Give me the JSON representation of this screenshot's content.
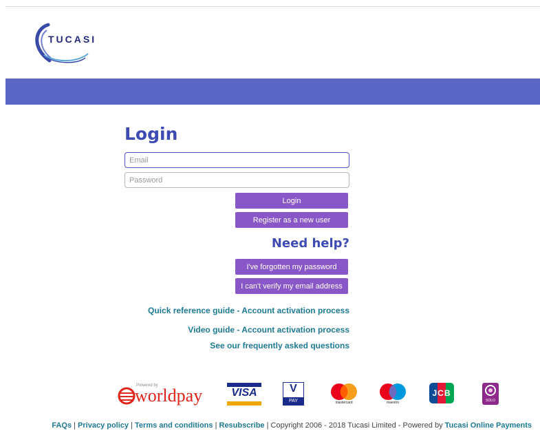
{
  "brand": {
    "name": "TUCASI",
    "color": "#3e4bb5",
    "banner_color": "#5a67c5",
    "button_color": "#8a57c8"
  },
  "login": {
    "title": "Login",
    "email_placeholder": "Email",
    "password_placeholder": "Password",
    "login_button": "Login",
    "register_button": "Register as a new user"
  },
  "help": {
    "title": "Need help?",
    "forgot_password_button": "I've forgotten my password",
    "verify_email_button": "I can't verify my email address",
    "links": [
      "Quick reference guide - Account activation process",
      "Video guide - Account activation process",
      "See our frequently asked questions"
    ]
  },
  "payment_logos": {
    "worldpay_small": "Powered by",
    "worldpay": "worldpay",
    "visa": "VISA",
    "vpay_v": "V",
    "vpay": "PAY",
    "mastercard": "mastercard",
    "maestro": "maestro",
    "jcb": "JCB",
    "solo": "SOLO"
  },
  "footer": {
    "faqs": "FAQs",
    "sep": "|",
    "privacy": "Privacy policy",
    "terms": "Terms and conditions",
    "resubscribe": "Resubscribe",
    "copyright": "Copyright 2006 - 2018 Tucasi Limited - Powered by",
    "powered_link": "Tucasi Online Payments"
  }
}
